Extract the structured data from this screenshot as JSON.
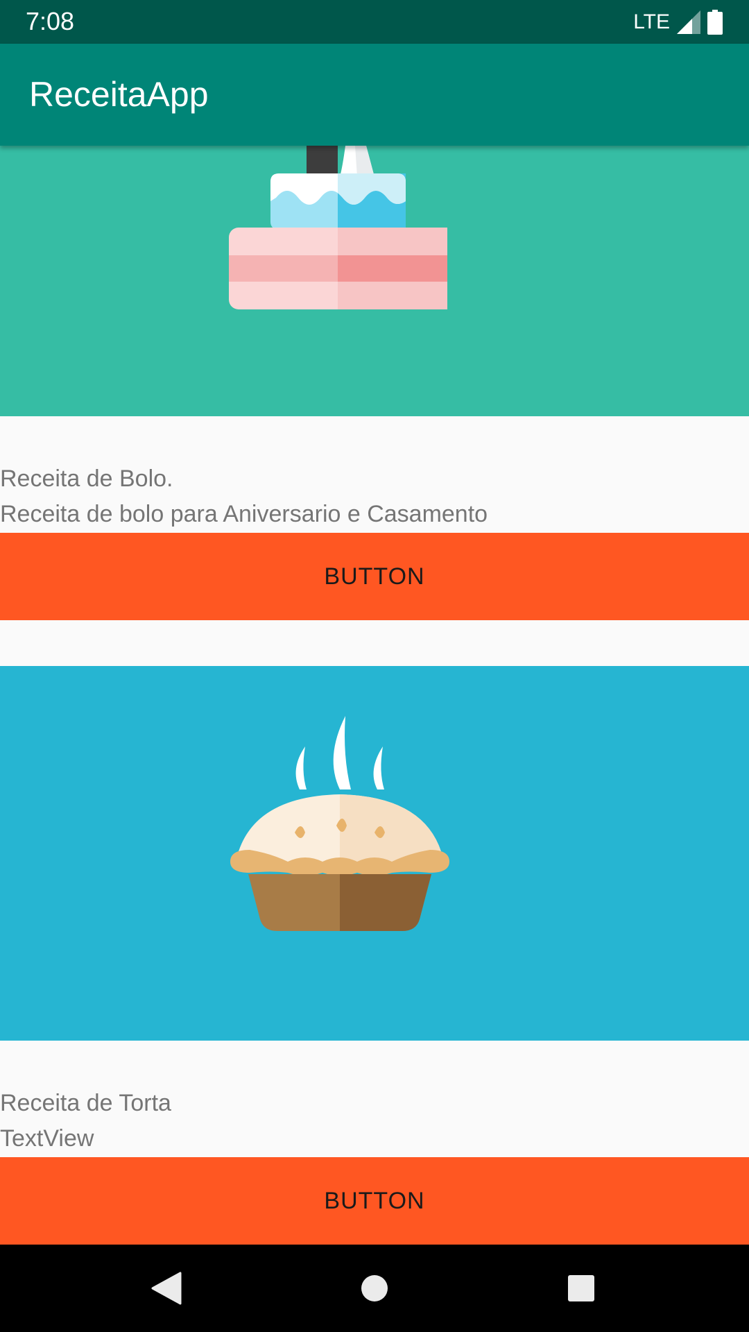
{
  "status_bar": {
    "time": "7:08",
    "network": "LTE"
  },
  "app_bar": {
    "title": "ReceitaApp"
  },
  "recipes": [
    {
      "image_icon": "wedding-cake-icon",
      "image_background": "#36bda4",
      "title": "Receita de Bolo.",
      "description": "Receita de bolo para Aniversario e Casamento",
      "button_label": "BUTTON"
    },
    {
      "image_icon": "pie-icon",
      "image_background": "#26b5d2",
      "title": "Receita de Torta",
      "description": "TextView",
      "button_label": "BUTTON"
    }
  ],
  "colors": {
    "status_bar": "#00574b",
    "app_bar": "#008577",
    "button": "#ff5722",
    "text_secondary": "#757575"
  },
  "nav_bar": {
    "icons": [
      "back-icon",
      "home-icon",
      "recents-icon"
    ]
  }
}
